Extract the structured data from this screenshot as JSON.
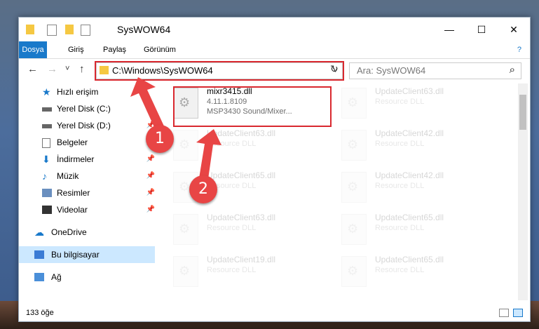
{
  "window": {
    "title": "SysWOW64",
    "minimize": "—",
    "maximize": "☐",
    "close": "✕"
  },
  "ribbon": {
    "tabs": [
      "Dosya",
      "Giriş",
      "Paylaş",
      "Görünüm"
    ],
    "help": "?"
  },
  "nav": {
    "back": "←",
    "forward": "→",
    "recent": "˅",
    "up": "↑",
    "address": "C:\\Windows\\SysWOW64",
    "refresh": "↻",
    "search_placeholder": "Ara: SysWOW64",
    "search_icon": "⌕"
  },
  "sidebar": {
    "items": [
      {
        "label": "Hızlı erişim",
        "icon": "star-icon",
        "pin": ""
      },
      {
        "label": "Yerel Disk (C:)",
        "icon": "drive-icon",
        "pin": "📌"
      },
      {
        "label": "Yerel Disk (D:)",
        "icon": "drive-icon",
        "pin": "📌"
      },
      {
        "label": "Belgeler",
        "icon": "documents-icon",
        "pin": "📌"
      },
      {
        "label": "İndirmeler",
        "icon": "downloads-icon",
        "pin": "📌"
      },
      {
        "label": "Müzik",
        "icon": "music-icon",
        "pin": "📌"
      },
      {
        "label": "Resimler",
        "icon": "pictures-icon",
        "pin": "📌"
      },
      {
        "label": "Videolar",
        "icon": "videos-icon",
        "pin": "📌"
      },
      {
        "label": "OneDrive",
        "icon": "cloud-icon",
        "pin": ""
      },
      {
        "label": "Bu bilgisayar",
        "icon": "computer-icon",
        "pin": ""
      },
      {
        "label": "Ağ",
        "icon": "network-icon",
        "pin": ""
      }
    ]
  },
  "files": [
    {
      "name": "mixr3415.dll",
      "type": "4.11.1.8109",
      "desc": "MSP3430 Sound/Mixer..."
    },
    {
      "name": "UpdateClient63.dll",
      "type": "Resource DLL",
      "desc": ""
    },
    {
      "name": "UpdateClient63.dll",
      "type": "Resource DLL",
      "desc": ""
    },
    {
      "name": "UpdateClient42.dll",
      "type": "Resource DLL",
      "desc": ""
    },
    {
      "name": "UpdateClient65.dll",
      "type": "Resource DLL",
      "desc": ""
    },
    {
      "name": "UpdateClient42.dll",
      "type": "Resource DLL",
      "desc": ""
    },
    {
      "name": "UpdateClient63.dll",
      "type": "Resource DLL",
      "desc": ""
    },
    {
      "name": "UpdateClient65.dll",
      "type": "Resource DLL",
      "desc": ""
    },
    {
      "name": "UpdateClient19.dll",
      "type": "Resource DLL",
      "desc": ""
    },
    {
      "name": "UpdateClient65.dll",
      "type": "Resource DLL",
      "desc": ""
    }
  ],
  "status": {
    "count": "133 öğe"
  },
  "badges": [
    "1",
    "2"
  ],
  "colors": {
    "accent": "#1979ca",
    "highlight": "#d9282f",
    "badge": "#e84545"
  }
}
